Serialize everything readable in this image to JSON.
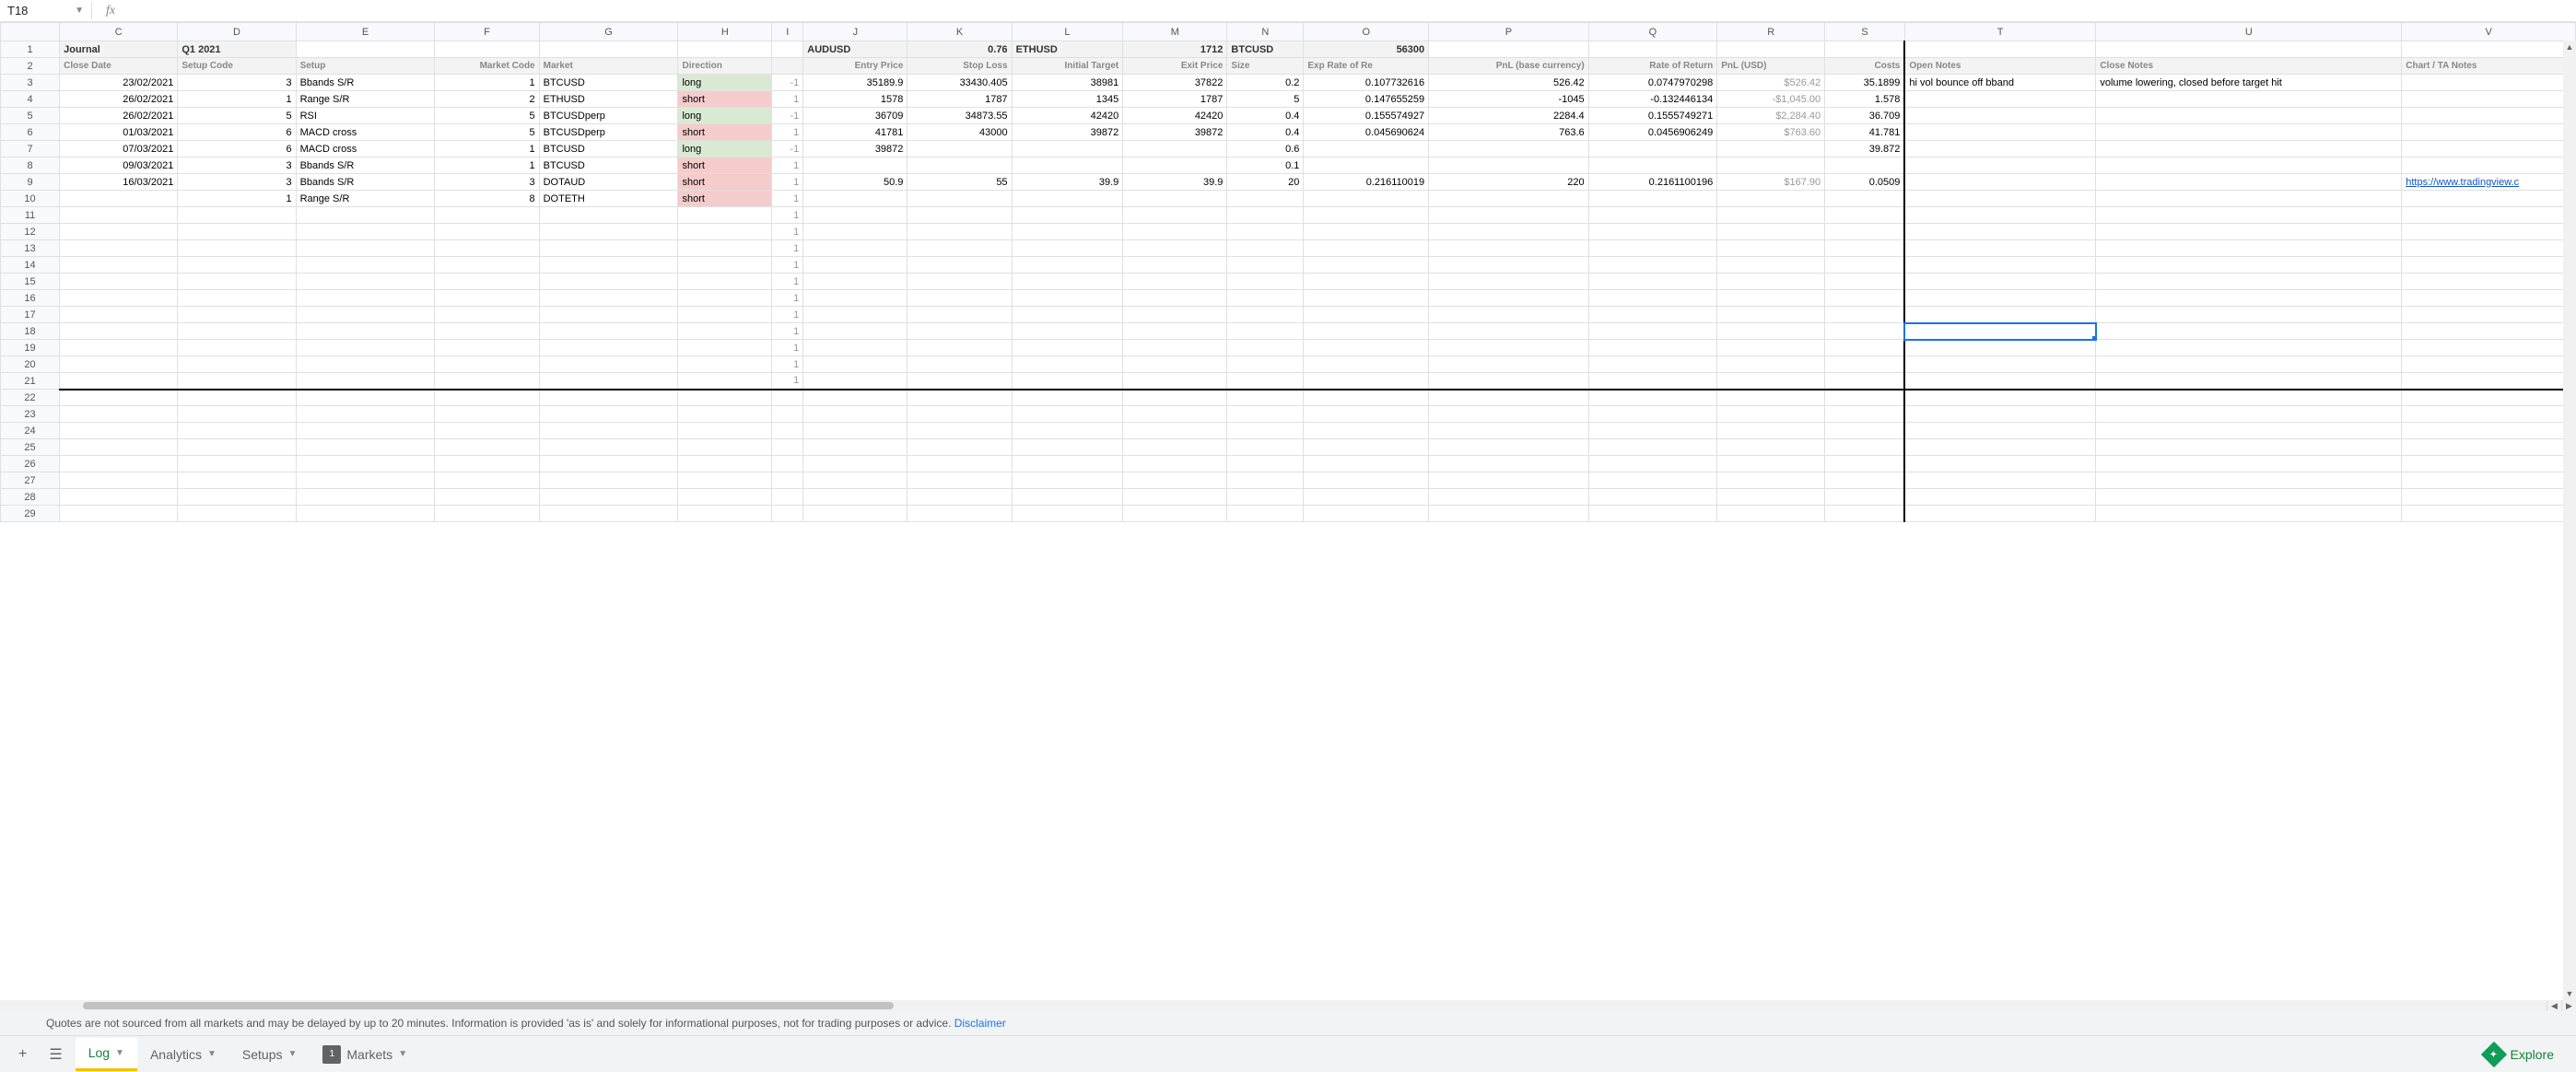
{
  "namebox": "T18",
  "formula": "",
  "columns": [
    "C",
    "D",
    "E",
    "F",
    "G",
    "H",
    "I",
    "J",
    "K",
    "L",
    "M",
    "N",
    "O",
    "P",
    "Q",
    "R",
    "S",
    "T",
    "U",
    "V"
  ],
  "colClasses": [
    "col-C",
    "col-D",
    "col-E",
    "col-F",
    "col-G",
    "col-H",
    "col-I",
    "col-J",
    "col-K",
    "col-L",
    "col-M",
    "col-N",
    "col-O",
    "col-P",
    "col-Q",
    "col-R",
    "col-S",
    "col-T",
    "col-U",
    "col-V"
  ],
  "row1": {
    "C": "Journal",
    "D": "Q1 2021",
    "J": "AUDUSD",
    "K": "0.76",
    "L": "ETHUSD",
    "M": "1712",
    "N": "BTCUSD",
    "O": "56300"
  },
  "row2": {
    "C": "Close Date",
    "D": "Setup Code",
    "E": "Setup",
    "F": "Market Code",
    "G": "Market",
    "H": "Direction",
    "I": "",
    "J": "Entry Price",
    "K": "Stop Loss",
    "L": "Initial Target",
    "M": "Exit Price",
    "N": "Size",
    "O": "Exp Rate of Re",
    "P": "PnL (base currency)",
    "Q": "Rate of Return",
    "R": "PnL (USD)",
    "S": "Costs",
    "T": "Open Notes",
    "U": "Close Notes",
    "V": "Chart / TA Notes"
  },
  "row2_bold": [
    "C",
    "D",
    "F",
    "J",
    "K",
    "L",
    "M",
    "P",
    "Q",
    "S",
    "T",
    "U",
    "V"
  ],
  "dataRows": [
    {
      "n": 3,
      "C": "23/02/2021",
      "D": "3",
      "E": "Bbands S/R",
      "F": "1",
      "G": "BTCUSD",
      "H": "long",
      "I": "-1",
      "J": "35189.9",
      "K": "33430.405",
      "L": "38981",
      "M": "37822",
      "N": "0.2",
      "O": "0.107732616",
      "P": "526.42",
      "Q": "0.0747970298",
      "R": "$526.42",
      "S": "35.1899",
      "T": "hi vol bounce off bband",
      "U": "volume lowering, closed before target hit"
    },
    {
      "n": 4,
      "C": "26/02/2021",
      "D": "1",
      "E": "Range S/R",
      "F": "2",
      "G": "ETHUSD",
      "H": "short",
      "I": "1",
      "J": "1578",
      "K": "1787",
      "L": "1345",
      "M": "1787",
      "N": "5",
      "O": "0.147655259",
      "P": "-1045",
      "Q": "-0.132446134",
      "R": "-$1,045.00",
      "S": "1.578"
    },
    {
      "n": 5,
      "C": "26/02/2021",
      "D": "5",
      "E": "RSI",
      "F": "5",
      "G": "BTCUSDperp",
      "H": "long",
      "I": "-1",
      "J": "36709",
      "K": "34873.55",
      "L": "42420",
      "M": "42420",
      "N": "0.4",
      "O": "0.155574927",
      "P": "2284.4",
      "Q": "0.1555749271",
      "R": "$2,284.40",
      "S": "36.709"
    },
    {
      "n": 6,
      "C": "01/03/2021",
      "D": "6",
      "E": "MACD cross",
      "F": "5",
      "G": "BTCUSDperp",
      "H": "short",
      "I": "1",
      "J": "41781",
      "K": "43000",
      "L": "39872",
      "M": "39872",
      "N": "0.4",
      "O": "0.045690624",
      "P": "763.6",
      "Q": "0.0456906249",
      "R": "$763.60",
      "S": "41.781"
    },
    {
      "n": 7,
      "C": "07/03/2021",
      "D": "6",
      "E": "MACD cross",
      "F": "1",
      "G": "BTCUSD",
      "H": "long",
      "I": "-1",
      "J": "39872",
      "N": "0.6",
      "S": "39.872"
    },
    {
      "n": 8,
      "C": "09/03/2021",
      "D": "3",
      "E": "Bbands S/R",
      "F": "1",
      "G": "BTCUSD",
      "H": "short",
      "I": "1",
      "N": "0.1"
    },
    {
      "n": 9,
      "C": "16/03/2021",
      "D": "3",
      "E": "Bbands S/R",
      "F": "3",
      "G": "DOTAUD",
      "H": "short",
      "I": "1",
      "J": "50.9",
      "K": "55",
      "L": "39.9",
      "M": "39.9",
      "N": "20",
      "O": "0.216110019",
      "P": "220",
      "Q": "0.2161100196",
      "R": "$167.90",
      "S": "0.0509",
      "V": "https://www.tradingview.c"
    },
    {
      "n": 10,
      "D": "1",
      "E": "Range S/R",
      "F": "8",
      "G": "DOTETH",
      "H": "short",
      "I": "1"
    }
  ],
  "emptyRows": [
    11,
    12,
    13,
    14,
    15,
    16,
    17,
    18,
    19,
    20,
    21,
    22,
    23,
    24,
    25,
    26,
    27,
    28,
    29
  ],
  "disclaimer": "Quotes are not sourced from all markets and may be delayed by up to 20 minutes. Information is provided 'as is' and solely for informational purposes, not for trading purposes or advice.",
  "disclaimerLink": "Disclaimer",
  "tabs": [
    {
      "label": "Log",
      "active": true
    },
    {
      "label": "Analytics"
    },
    {
      "label": "Setups"
    },
    {
      "label": "Markets",
      "badge": "1"
    }
  ],
  "explore": "Explore",
  "selectedCell": {
    "row": 18,
    "col": "T"
  }
}
